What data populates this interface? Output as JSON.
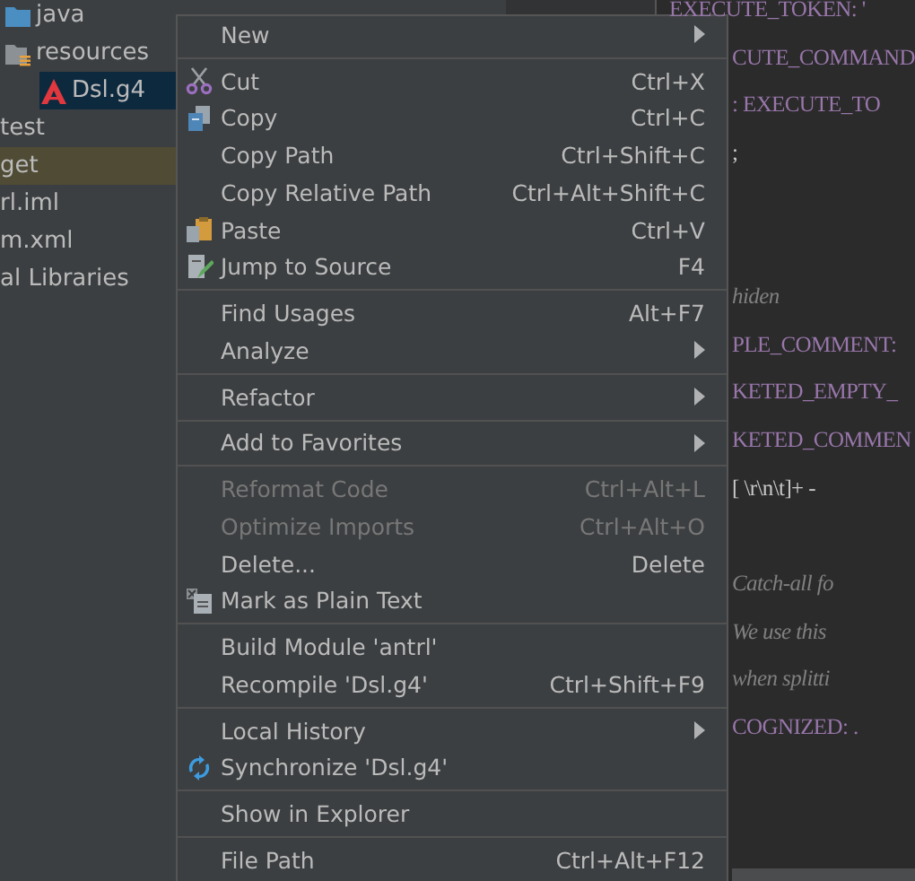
{
  "project_tree": [
    {
      "children": [
        {
          "label": "java",
          "kind": "folder",
          "selected": false,
          "highlighted": false
        },
        {
          "label": "resources",
          "kind": "resource-folder",
          "selected": false,
          "highlighted": false,
          "children": [
            {
              "label": "Dsl.g4",
              "kind": "grammar-file",
              "selected": true
            }
          ]
        }
      ]
    },
    {
      "label": "test",
      "selected": false,
      "highlighted": false
    },
    {
      "label": "get",
      "selected": false,
      "highlighted": true
    },
    {
      "label": "rl.iml",
      "selected": false,
      "highlighted": false
    },
    {
      "label": "m.xml",
      "selected": false,
      "highlighted": false
    },
    {
      "label": "al Libraries",
      "selected": false,
      "highlighted": false
    }
  ],
  "editor_lines": [
    {
      "kind": "token",
      "text": "EXECUTE_TOKEN: '",
      "clipped": false
    },
    {
      "kind": "token",
      "text": "CUTE_COMMAND",
      "clipped": true
    },
    {
      "kind": "token",
      "text": ": EXECUTE_TO",
      "clipped": true
    },
    {
      "kind": "plain",
      "text": ";",
      "clipped": true
    },
    {
      "kind": "blank"
    },
    {
      "kind": "blank"
    },
    {
      "kind": "comment",
      "text": "hiden",
      "clipped": true
    },
    {
      "kind": "token",
      "text": "PLE_COMMENT:",
      "clipped": true
    },
    {
      "kind": "token",
      "text": "KETED_EMPTY_",
      "clipped": true
    },
    {
      "kind": "token",
      "text": "KETED_COMMEN",
      "clipped": true
    },
    {
      "kind": "plain",
      "text": "[ \\r\\n\\t]+ -",
      "clipped": true
    },
    {
      "kind": "blank"
    },
    {
      "kind": "comment",
      "text": "Catch-all fo",
      "clipped": true
    },
    {
      "kind": "comment",
      "text": "We use this",
      "clipped": true
    },
    {
      "kind": "comment",
      "text": "when splitti",
      "clipped": true
    },
    {
      "kind": "token",
      "text": "COGNIZED: .",
      "clipped": true
    }
  ],
  "context_menu": [
    [
      {
        "label": "New",
        "submenu": true,
        "disabled": false
      }
    ],
    [
      {
        "label": "Cut",
        "kind": "scissors",
        "shortcut": "Ctrl+X",
        "disabled": false
      },
      {
        "label": "Copy",
        "kind": "copy",
        "shortcut": "Ctrl+C",
        "disabled": false
      },
      {
        "label": "Copy Path",
        "shortcut": "Ctrl+Shift+C",
        "disabled": false
      },
      {
        "label": "Copy Relative Path",
        "shortcut": "Ctrl+Alt+Shift+C",
        "disabled": false
      },
      {
        "label": "Paste",
        "kind": "paste",
        "shortcut": "Ctrl+V",
        "disabled": false
      },
      {
        "label": "Jump to Source",
        "kind": "edit",
        "shortcut": "F4",
        "disabled": false
      }
    ],
    [
      {
        "label": "Find Usages",
        "shortcut": "Alt+F7",
        "disabled": false
      },
      {
        "label": "Analyze",
        "submenu": true,
        "disabled": false
      }
    ],
    [
      {
        "label": "Refactor",
        "submenu": true,
        "disabled": false
      }
    ],
    [
      {
        "label": "Add to Favorites",
        "submenu": true,
        "disabled": false
      }
    ],
    [
      {
        "label": "Reformat Code",
        "shortcut": "Ctrl+Alt+L",
        "disabled": true
      },
      {
        "label": "Optimize Imports",
        "shortcut": "Ctrl+Alt+O",
        "disabled": true
      },
      {
        "label": "Delete...",
        "shortcut": "Delete",
        "disabled": false
      },
      {
        "label": "Mark as Plain Text",
        "kind": "plain-text",
        "disabled": false
      }
    ],
    [
      {
        "label": "Build Module 'antrl'",
        "disabled": false
      },
      {
        "label": "Recompile 'Dsl.g4'",
        "shortcut": "Ctrl+Shift+F9",
        "disabled": false
      }
    ],
    [
      {
        "label": "Local History",
        "submenu": true,
        "disabled": false
      },
      {
        "label": "Synchronize 'Dsl.g4'",
        "kind": "sync",
        "disabled": false
      }
    ],
    [
      {
        "label": "Show in Explorer",
        "disabled": false
      }
    ],
    [
      {
        "label": "File Path",
        "shortcut": "Ctrl+Alt+F12",
        "disabled": false
      }
    ]
  ]
}
